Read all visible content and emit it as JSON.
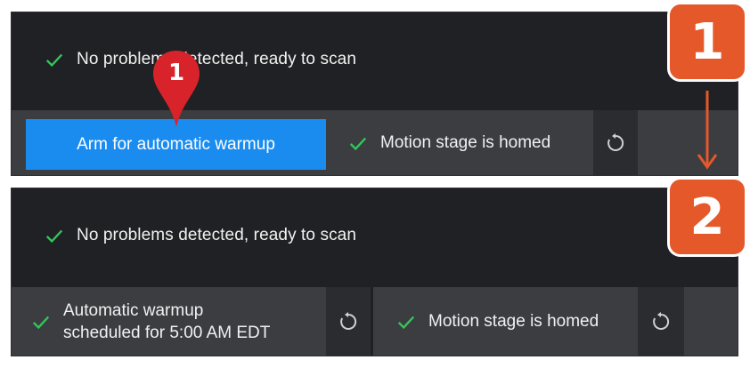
{
  "panel1": {
    "status_text": "No problems detected, ready to scan",
    "arm_button_label": "Arm for automatic warmup",
    "stage_status": "Motion stage is homed"
  },
  "panel2": {
    "status_text": "No problems detected, ready to scan",
    "warmup_line1": "Automatic warmup",
    "warmup_line2": "scheduled for 5:00 AM EDT",
    "stage_status": "Motion stage is homed"
  },
  "callouts": {
    "pin_number": "1",
    "step1_label": "1",
    "step2_label": "2"
  },
  "colors": {
    "panel_bg": "#202124",
    "bar_bg": "#3b3d41",
    "accent_blue": "#1a8cf0",
    "check_green": "#34c759",
    "badge_orange": "#e5582a",
    "pin_red": "#d8232a"
  },
  "icons": {
    "status": "check-icon",
    "refresh": "refresh-icon",
    "pin": "map-pin-icon",
    "arrow": "arrow-down-icon"
  }
}
